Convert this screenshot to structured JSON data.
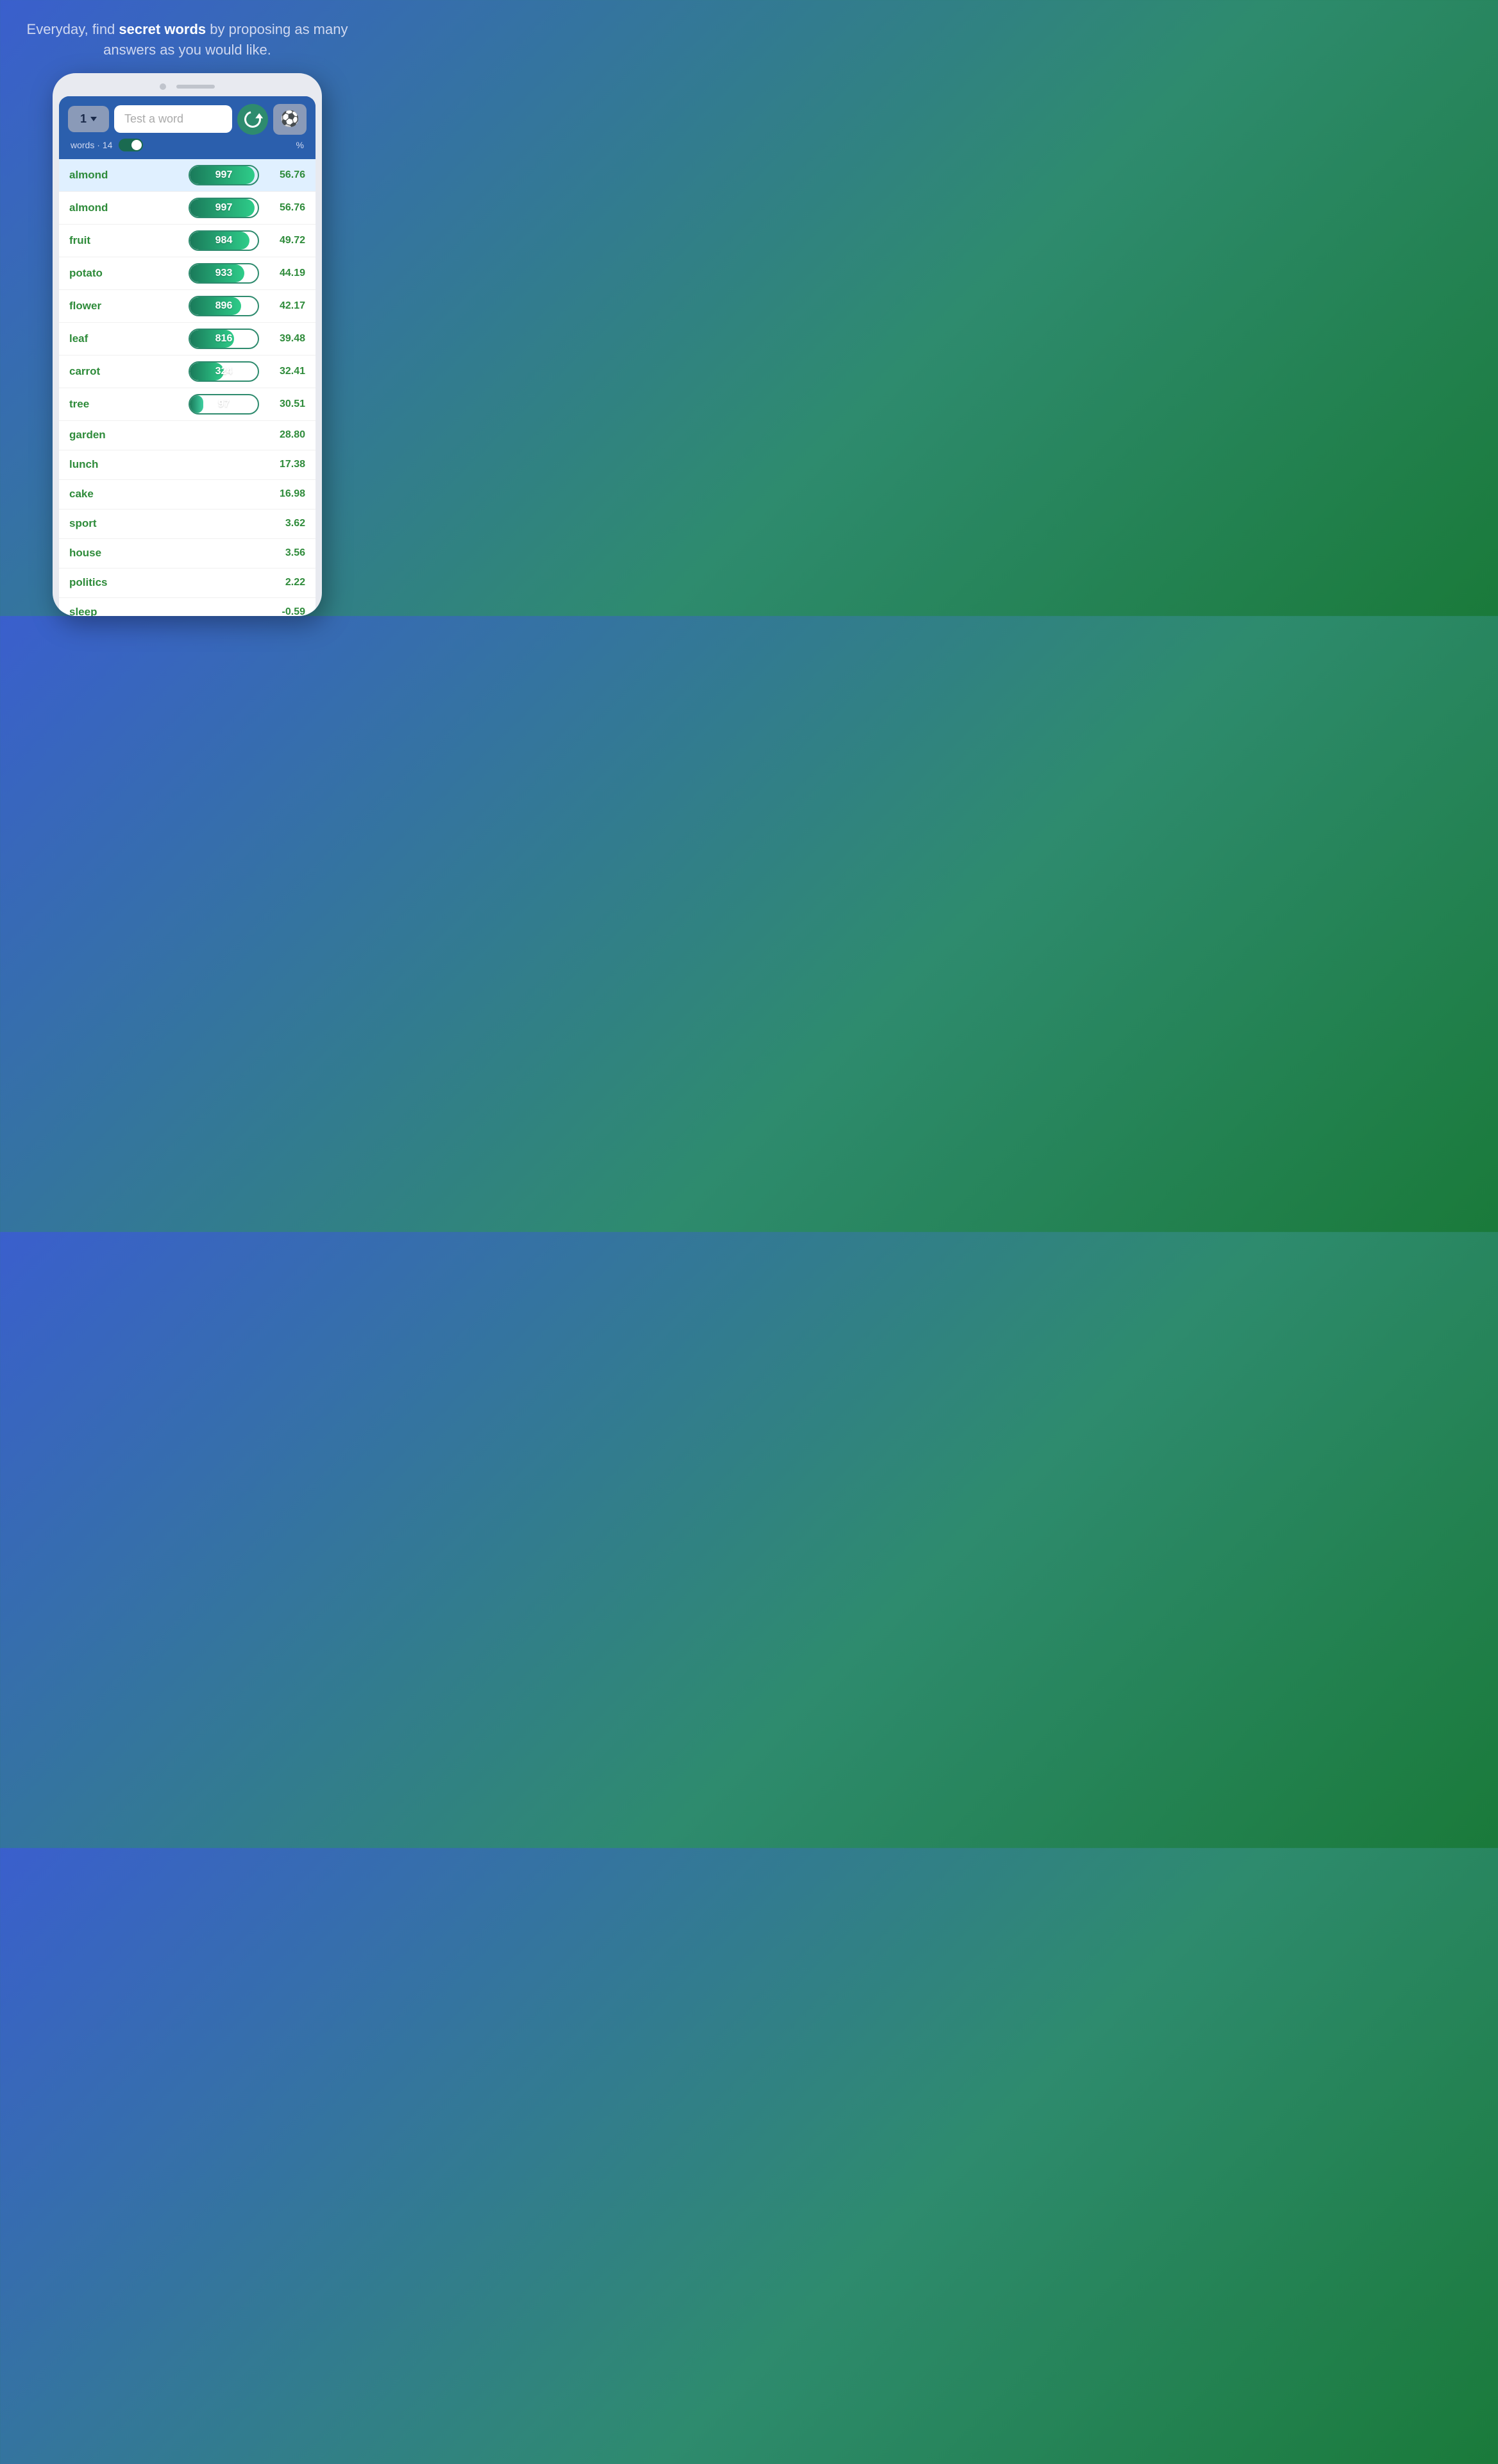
{
  "headline": {
    "part1": "Everyday, find ",
    "bold": "secret words",
    "part2": " by proposing as many answers as you would like."
  },
  "app": {
    "dropdown_value": "1",
    "input_placeholder": "Test a word",
    "stats_label": "words · 14",
    "percent_label": "%",
    "rows": [
      {
        "word": "almond",
        "score": 997,
        "score_width": 95,
        "pct": "56.76",
        "highlighted": true
      },
      {
        "word": "almond",
        "score": 997,
        "score_width": 95,
        "pct": "56.76",
        "highlighted": false
      },
      {
        "word": "fruit",
        "score": 984,
        "score_width": 88,
        "pct": "49.72",
        "highlighted": false
      },
      {
        "word": "potato",
        "score": 933,
        "score_width": 80,
        "pct": "44.19",
        "highlighted": false
      },
      {
        "word": "flower",
        "score": 896,
        "score_width": 75,
        "pct": "42.17",
        "highlighted": false
      },
      {
        "word": "leaf",
        "score": 816,
        "score_width": 65,
        "pct": "39.48",
        "highlighted": false
      },
      {
        "word": "carrot",
        "score": 324,
        "score_width": 50,
        "pct": "32.41",
        "highlighted": false
      },
      {
        "word": "tree",
        "score": 97,
        "score_width": 20,
        "pct": "30.51",
        "highlighted": false
      },
      {
        "word": "garden",
        "score": null,
        "score_width": 0,
        "pct": "28.80",
        "highlighted": false
      },
      {
        "word": "lunch",
        "score": null,
        "score_width": 0,
        "pct": "17.38",
        "highlighted": false
      },
      {
        "word": "cake",
        "score": null,
        "score_width": 0,
        "pct": "16.98",
        "highlighted": false
      },
      {
        "word": "sport",
        "score": null,
        "score_width": 0,
        "pct": "3.62",
        "highlighted": false
      },
      {
        "word": "house",
        "score": null,
        "score_width": 0,
        "pct": "3.56",
        "highlighted": false
      },
      {
        "word": "politics",
        "score": null,
        "score_width": 0,
        "pct": "2.22",
        "highlighted": false
      },
      {
        "word": "sleep",
        "score": null,
        "score_width": 0,
        "pct": "-0.59",
        "highlighted": false,
        "negative": true
      }
    ]
  }
}
